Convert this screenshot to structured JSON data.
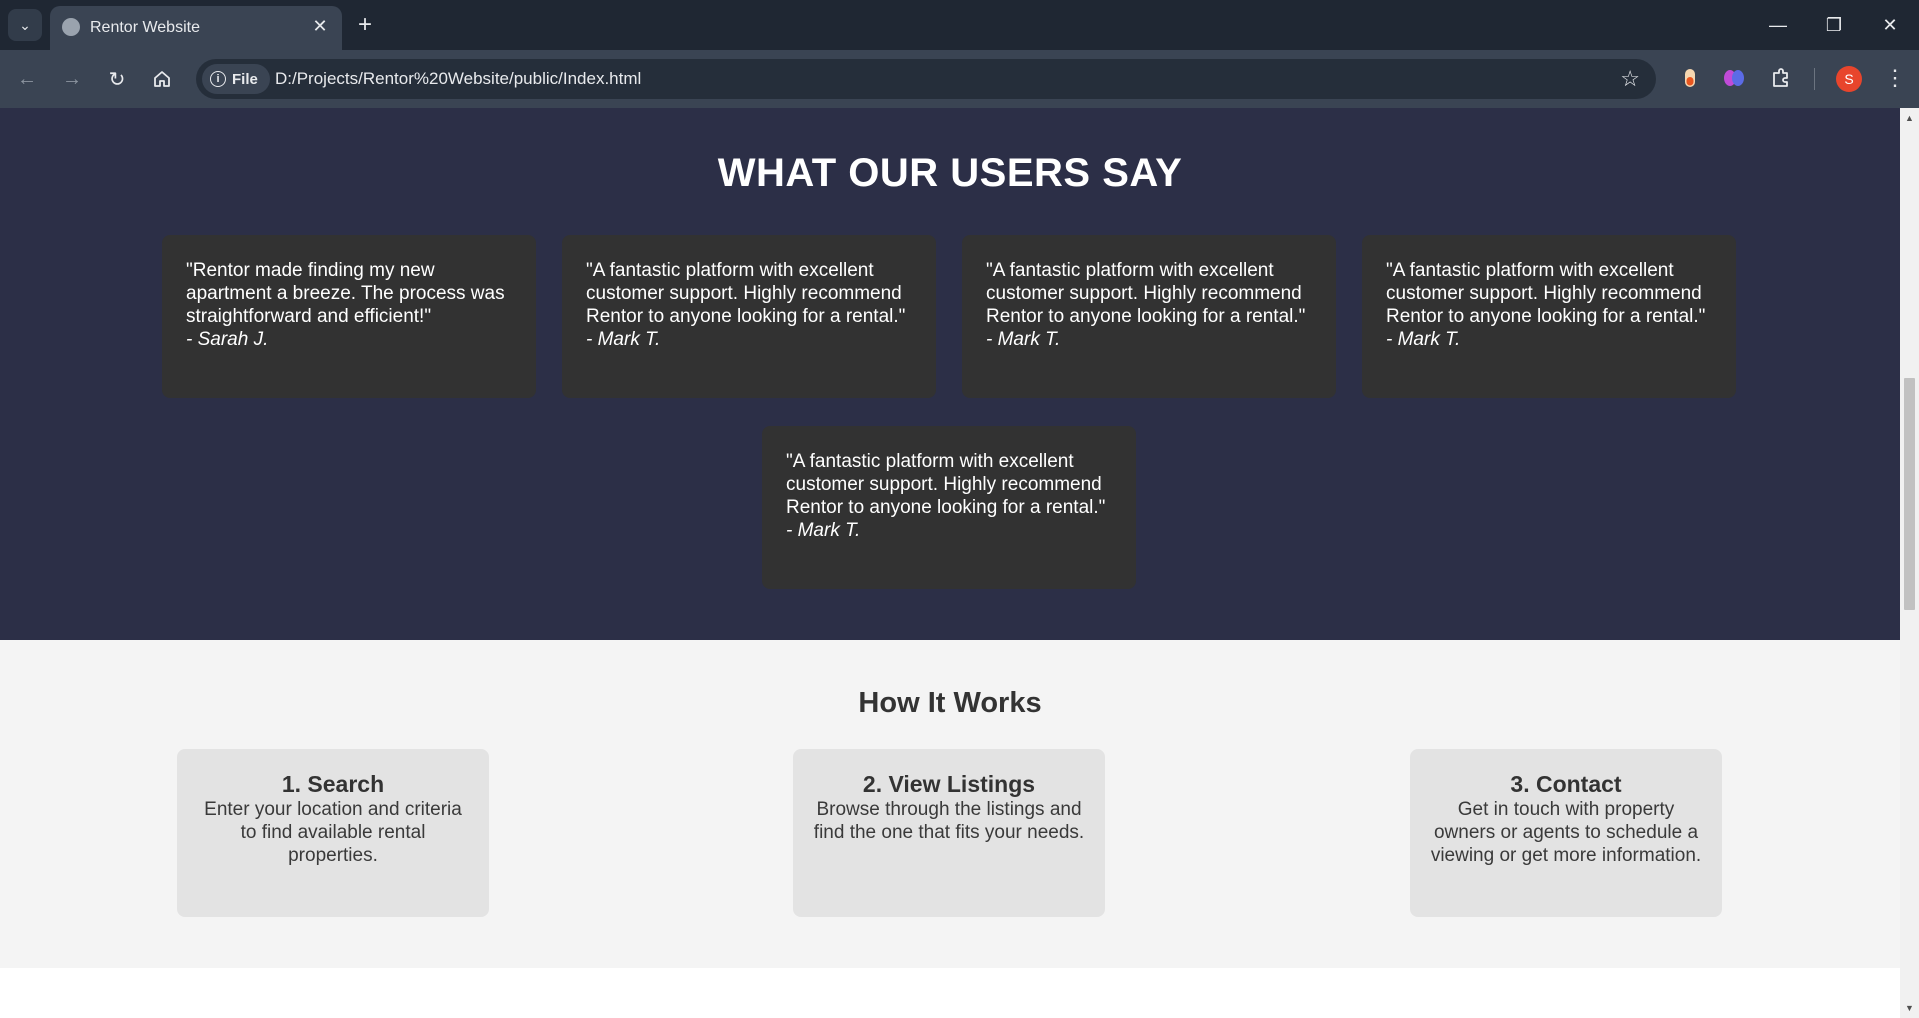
{
  "browser": {
    "tab_title": "Rentor Website",
    "scheme_chip": "File",
    "url": "D:/Projects/Rentor%20Website/public/Index.html",
    "profile_initial": "S"
  },
  "testimonials": {
    "title": "WHAT OUR USERS SAY",
    "items": [
      {
        "quote": "\"Rentor made finding my new apartment a breeze. The process was straightforward and efficient!\"",
        "author": "- Sarah J."
      },
      {
        "quote": "\"A fantastic platform with excellent customer support. Highly recommend Rentor to anyone looking for a rental.\"",
        "author": "- Mark T."
      },
      {
        "quote": "\"A fantastic platform with excellent customer support. Highly recommend Rentor to anyone looking for a rental.\"",
        "author": "- Mark T."
      },
      {
        "quote": "\"A fantastic platform with excellent customer support. Highly recommend Rentor to anyone looking for a rental.\"",
        "author": "- Mark T."
      },
      {
        "quote": "\"A fantastic platform with excellent customer support. Highly recommend Rentor to anyone looking for a rental.\"",
        "author": "- Mark T."
      }
    ]
  },
  "how_it_works": {
    "title": "How It Works",
    "steps": [
      {
        "title": "1. Search",
        "text": "Enter your location and criteria to find available rental properties."
      },
      {
        "title": "2. View Listings",
        "text": "Browse through the listings and find the one that fits your needs."
      },
      {
        "title": "3. Contact",
        "text": "Get in touch with property owners or agents to schedule a viewing or get more information."
      }
    ]
  },
  "colors": {
    "testimonials_bg": "#2c2f47",
    "card_bg": "#323232",
    "how_bg": "#f4f4f4",
    "step_bg": "#e3e3e3"
  }
}
